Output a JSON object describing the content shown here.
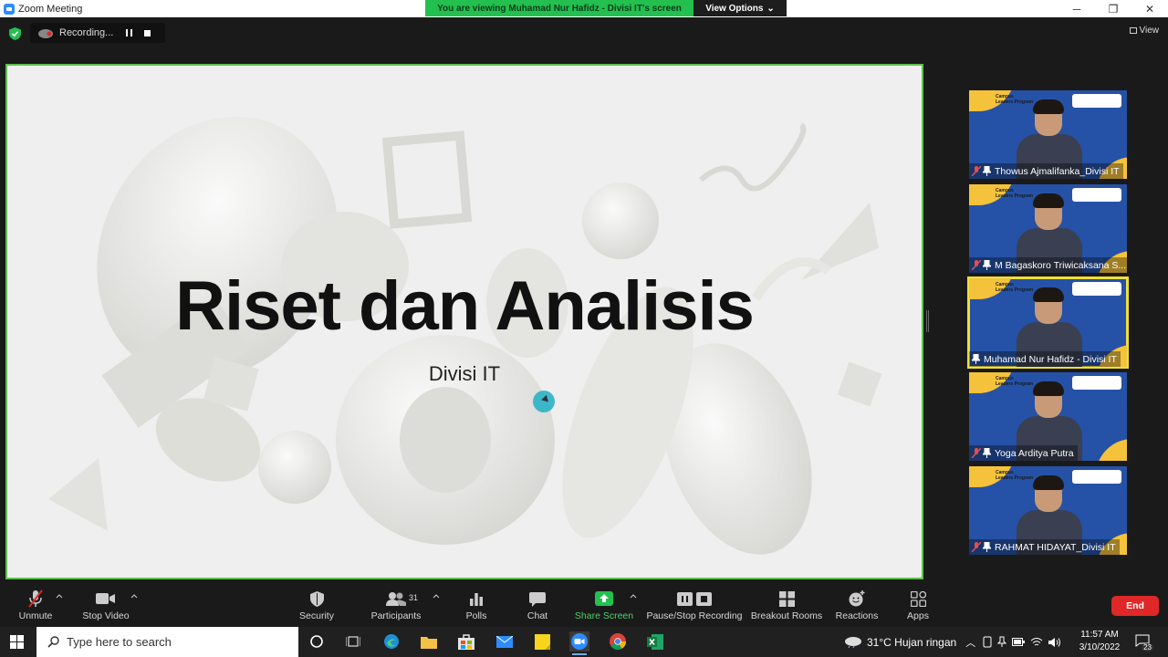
{
  "window": {
    "title": "Zoom Meeting",
    "min": "─",
    "max": "❐",
    "close": "✕"
  },
  "banner": {
    "message": "You are viewing Muhamad Nur Hafidz - Divisi IT's screen",
    "view_options": "View Options",
    "chevron": "⌄"
  },
  "recording": {
    "label": "Recording..."
  },
  "view": {
    "label": "View"
  },
  "slide": {
    "title": "Riset dan Analisis",
    "subtitle": "Divisi IT"
  },
  "participants": [
    {
      "name": "Thowus Ajmalifanka_Divisi IT",
      "muted": true,
      "active": false
    },
    {
      "name": "M Bagaskoro Triwicaksana S...",
      "muted": true,
      "active": false
    },
    {
      "name": "Muhamad Nur Hafidz - Divisi IT",
      "muted": false,
      "active": true
    },
    {
      "name": "Yoga Arditya Putra",
      "muted": true,
      "active": false
    },
    {
      "name": "RAHMAT HIDAYAT_Divisi IT",
      "muted": true,
      "active": false
    }
  ],
  "tile_badge": "Campus\nLeaders Program",
  "toolbar": {
    "unmute": "Unmute",
    "stop_video": "Stop Video",
    "security": "Security",
    "participants": "Participants",
    "participants_count": "31",
    "polls": "Polls",
    "chat": "Chat",
    "share_screen": "Share Screen",
    "pause_stop_recording": "Pause/Stop Recording",
    "breakout_rooms": "Breakout Rooms",
    "reactions": "Reactions",
    "apps": "Apps",
    "end": "End"
  },
  "taskbar": {
    "search_placeholder": "Type here to search",
    "weather": "31°C  Hujan ringan",
    "time": "11:57 AM",
    "date": "3/10/2022",
    "notifications": "23"
  },
  "colors": {
    "accent_green": "#23c04f",
    "share_border": "#5ec24e",
    "active_speaker": "#f0df3a",
    "end_red": "#e02828",
    "tile_blue": "#2552a6",
    "tile_yellow": "#f5c23b"
  }
}
